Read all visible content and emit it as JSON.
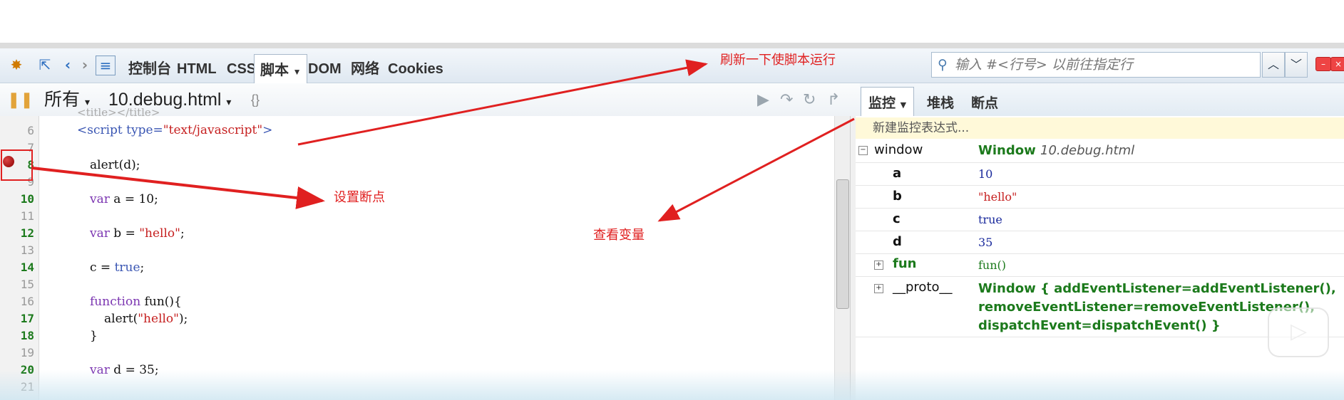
{
  "toolbar": {
    "tabs": [
      "控制台",
      "HTML",
      "CSS",
      "脚本",
      "DOM",
      "网络",
      "Cookies"
    ],
    "search_placeholder": "输入 #<行号> 以前往指定行"
  },
  "script_toolbar": {
    "filter": "所有",
    "file": "10.debug.html",
    "braces": "{}"
  },
  "right_tabs": [
    "监控",
    "堆栈",
    "断点"
  ],
  "editor": {
    "lines": [
      {
        "n": "6",
        "bold": false
      },
      {
        "n": "7",
        "bold": false
      },
      {
        "n": "8",
        "bold": true
      },
      {
        "n": "9",
        "bold": false
      },
      {
        "n": "10",
        "bold": true
      },
      {
        "n": "11",
        "bold": false
      },
      {
        "n": "12",
        "bold": true
      },
      {
        "n": "13",
        "bold": false
      },
      {
        "n": "14",
        "bold": true
      },
      {
        "n": "15",
        "bold": false
      },
      {
        "n": "16",
        "bold": false
      },
      {
        "n": "17",
        "bold": true
      },
      {
        "n": "18",
        "bold": true
      },
      {
        "n": "19",
        "bold": false
      },
      {
        "n": "20",
        "bold": true
      },
      {
        "n": "21",
        "bold": false
      }
    ],
    "code": {
      "script_open_tag": "<script type=",
      "script_type": "\"text/javascript\"",
      "script_close": ">",
      "alert_d": "alert(d);",
      "var_kw": "var",
      "a_rest": " a = 10;",
      "b_rest_pre": " b = ",
      "b_str": "\"hello\"",
      "b_end": ";",
      "c_pre": "c = ",
      "c_val": "true",
      "c_end": ";",
      "func_kw": "function",
      "func_rest": " fun(){",
      "alert_pre": "alert(",
      "alert_str": "\"hello\"",
      "alert_end": ");",
      "brace_close": "}",
      "d_rest": " d = 35;"
    }
  },
  "watch": {
    "new_expression": "新建监控表达式...",
    "window_name": "window",
    "window_value": "Window",
    "window_file": "10.debug.html",
    "vars": [
      {
        "name": "a",
        "value": "10",
        "color": "#1a2a9c"
      },
      {
        "name": "b",
        "value": "\"hello\"",
        "color": "#c62020"
      },
      {
        "name": "c",
        "value": "true",
        "color": "#1a2a9c"
      },
      {
        "name": "d",
        "value": "35",
        "color": "#1a2a9c"
      }
    ],
    "fun_name": "fun",
    "fun_value": "fun()",
    "proto_name": "__proto__",
    "proto_line1": "Window {  addEventListener=addEventListener(),",
    "proto_line2": "removeEventListener=removeEventListener(),",
    "proto_line3": "dispatchEvent=dispatchEvent() }"
  },
  "annotations": {
    "refresh": "刷新一下使脚本运行",
    "breakpoint": "设置断点",
    "view_vars": "查看变量"
  },
  "colors": {
    "annotation": "#e02020",
    "watch_green": "#1c7a1c"
  }
}
